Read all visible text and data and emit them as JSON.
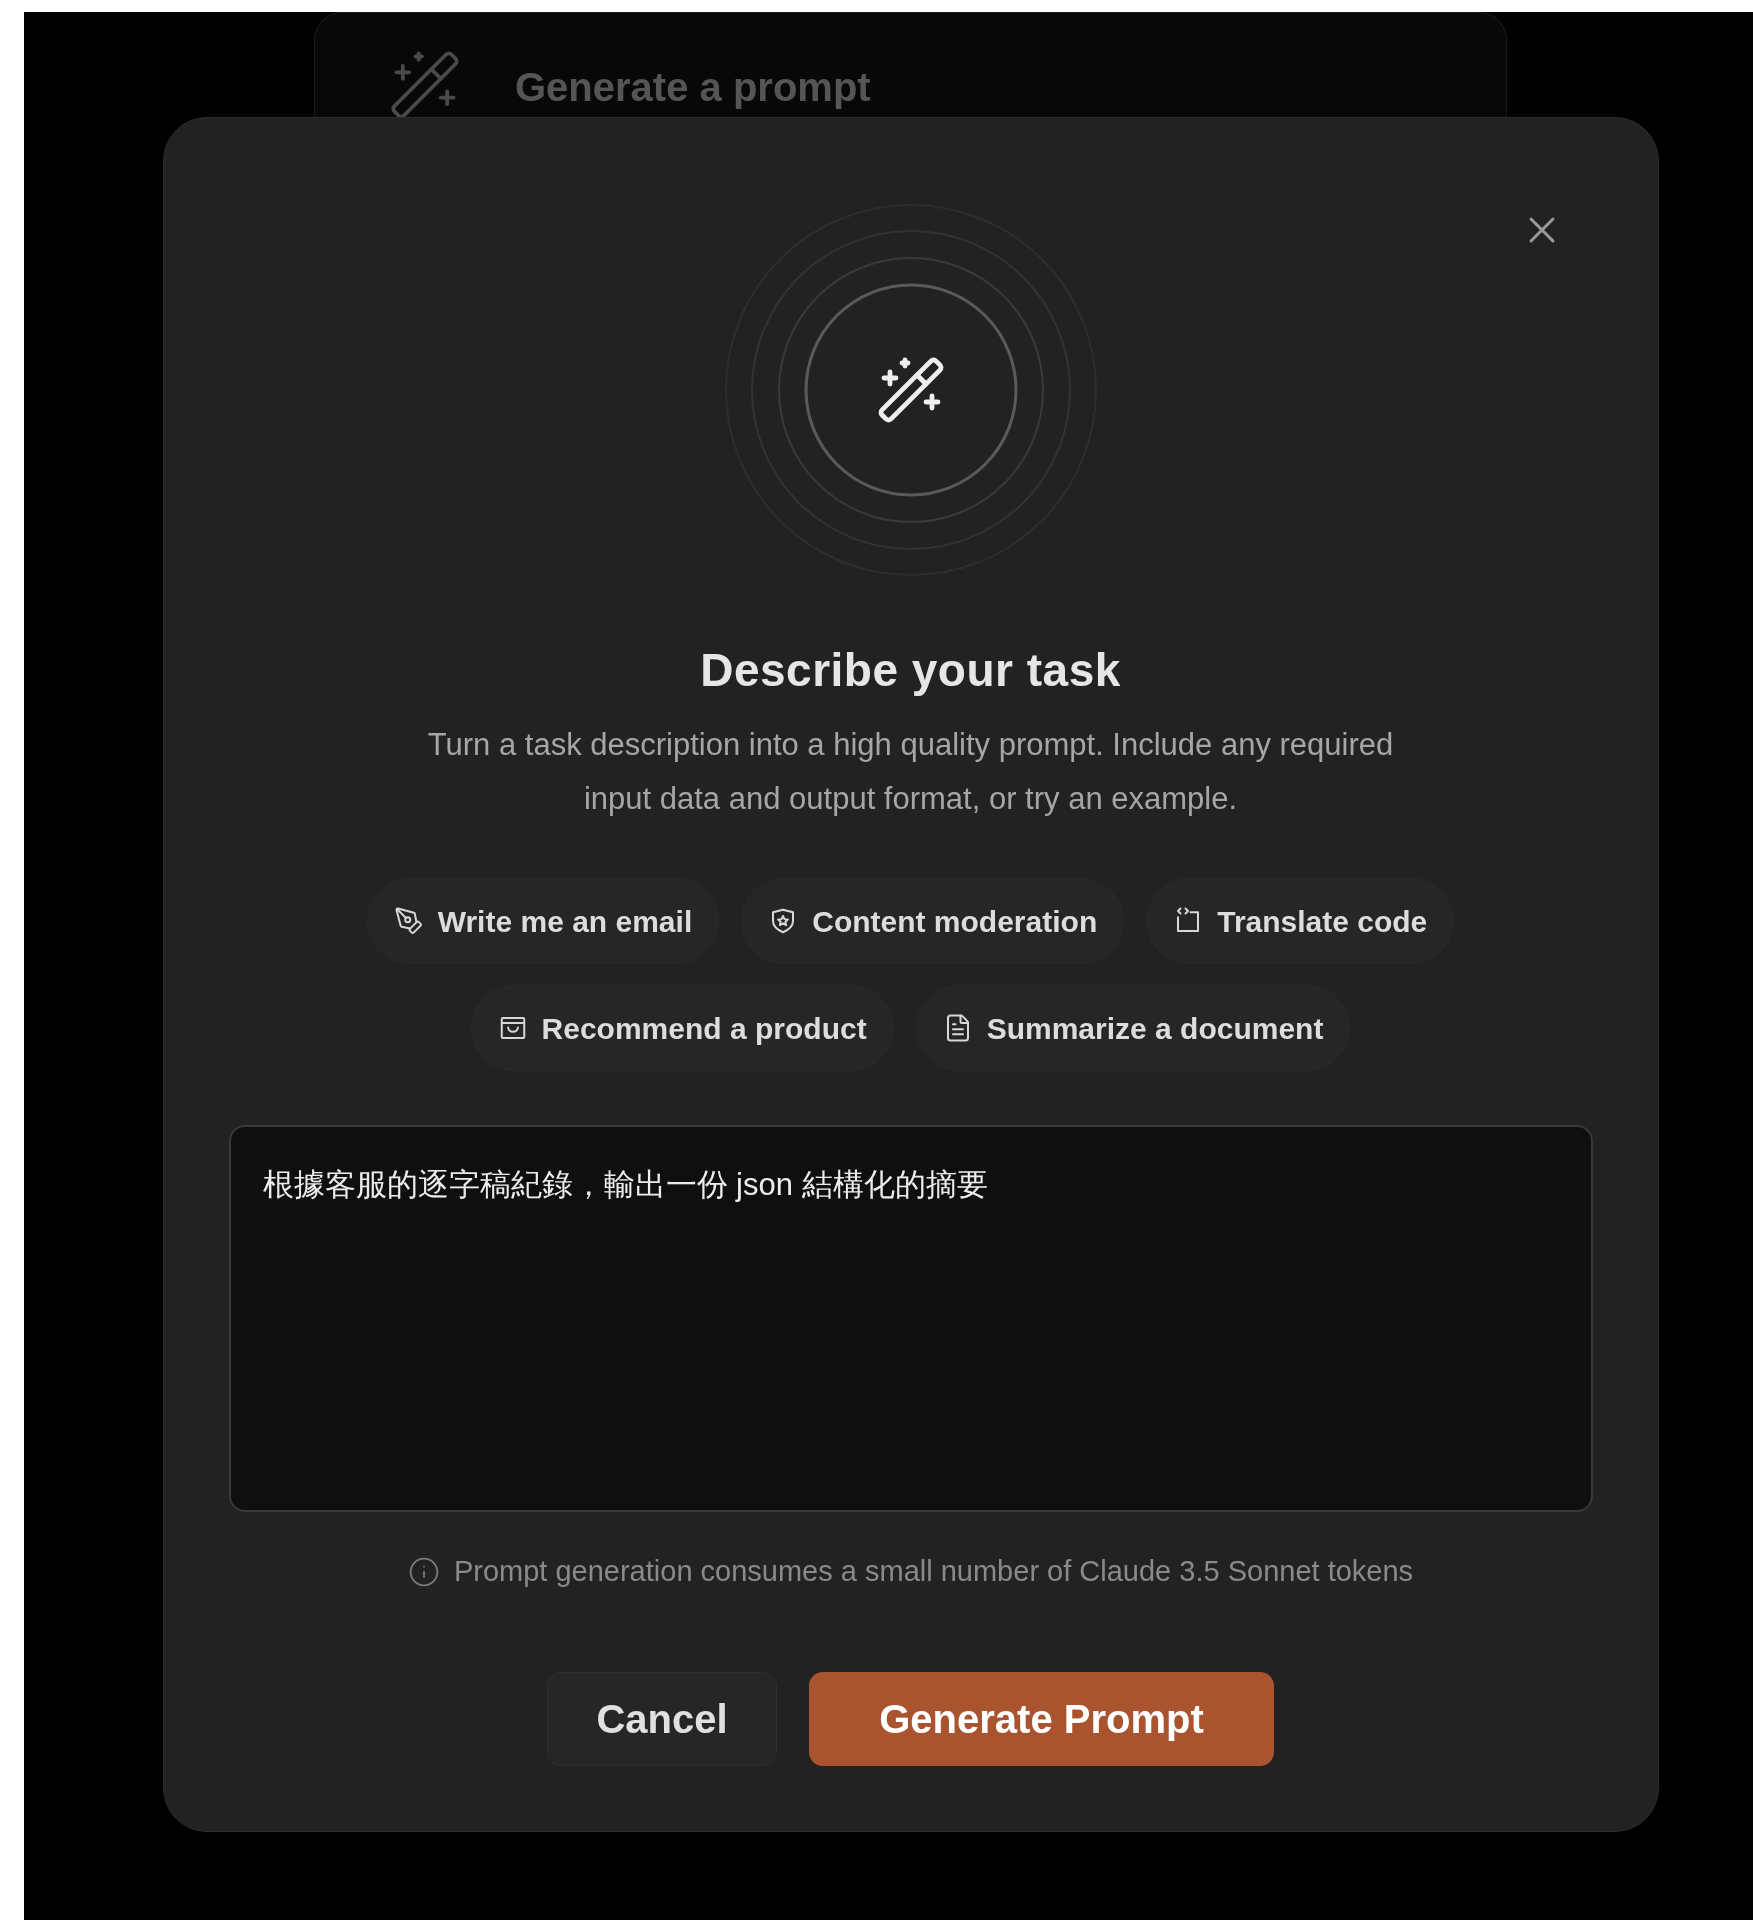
{
  "background_card": {
    "title": "Generate a prompt"
  },
  "dialog": {
    "heading": "Describe your task",
    "description": "Turn a task description into a high quality prompt. Include any required input data and output format, or try an example.",
    "examples": [
      {
        "label": "Write me an email",
        "kind": "pen"
      },
      {
        "label": "Content moderation",
        "kind": "shield"
      },
      {
        "label": "Translate code",
        "kind": "code"
      },
      {
        "label": "Recommend a product",
        "kind": "tray"
      },
      {
        "label": "Summarize a document",
        "kind": "document"
      }
    ],
    "task_field": {
      "value": "根據客服的逐字稿紀錄，輸出一份 json 結構化的摘要"
    },
    "note": "Prompt generation consumes a small number of Claude 3.5 Sonnet tokens",
    "buttons": [
      {
        "label": "Cancel",
        "kind": "secondary"
      },
      {
        "label": "Generate Prompt",
        "kind": "primary"
      }
    ]
  }
}
